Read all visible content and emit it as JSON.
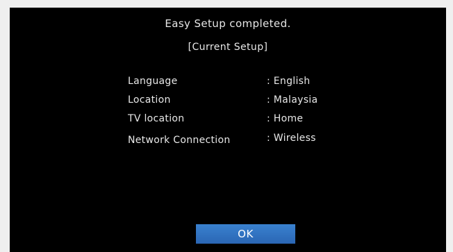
{
  "dialog": {
    "title": "Easy Setup completed.",
    "subtitle": "[Current Setup]",
    "settings": [
      {
        "label": "Language",
        "value": "English"
      },
      {
        "label": "Location",
        "value": "Malaysia"
      },
      {
        "label": "TV location",
        "value": "Home"
      },
      {
        "label": "Network Connection",
        "value": "Wireless"
      }
    ],
    "ok_label": "OK"
  },
  "colors": {
    "background": "#000000",
    "text": "#e8e8e8",
    "button": "#2f72c2",
    "frame": "#efefef"
  }
}
